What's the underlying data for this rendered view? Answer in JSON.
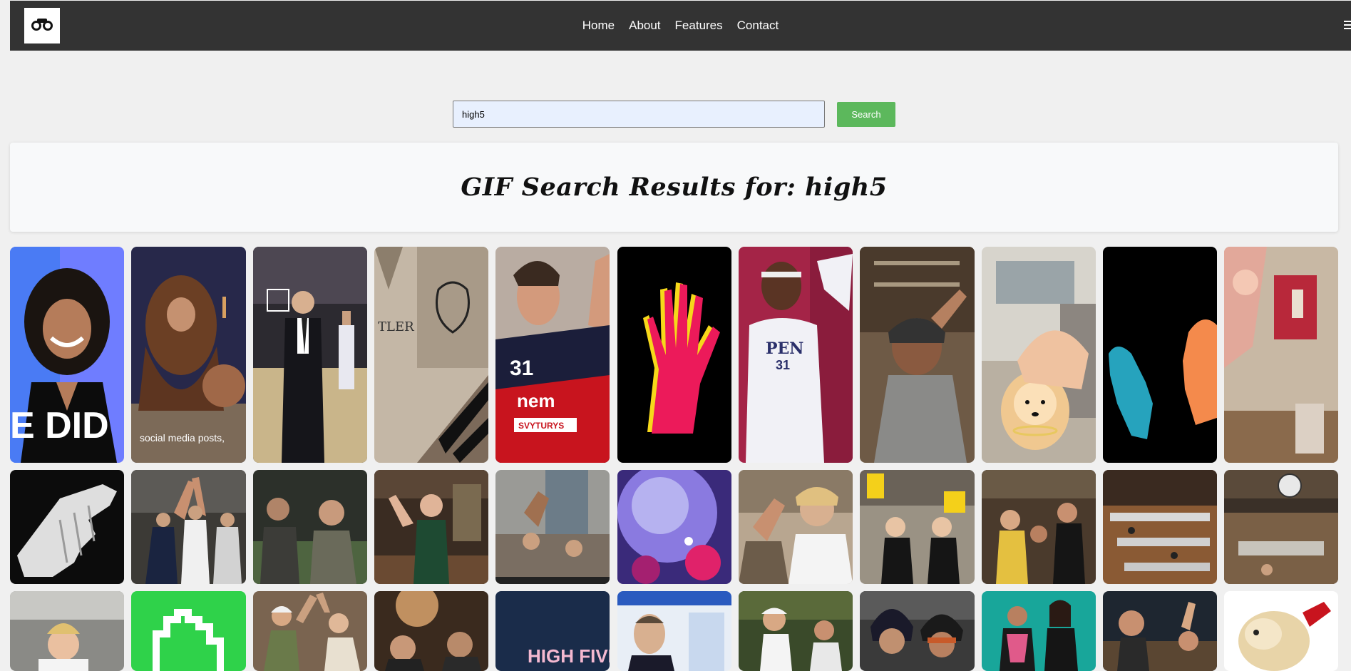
{
  "nav": {
    "logo_icon": "binoculars-icon",
    "links": [
      "Home",
      "About",
      "Features",
      "Contact"
    ],
    "menu_icon": "hamburger-menu-icon"
  },
  "search": {
    "value": "high5",
    "button_label": "Search"
  },
  "results": {
    "title": "GIF Search Results for: high5"
  },
  "gif_captions": {
    "gif_1": "E DID",
    "gif_2": "social media posts,",
    "gif_5_number": "31",
    "gif_5_brand": "nem",
    "gif_5_sponsor": "SVYTURYS",
    "gif_7_text": "PEN",
    "gif_7_number": "31",
    "gif_25_text": "HIGH FIVES"
  },
  "colors": {
    "navbar_bg": "#333333",
    "page_bg": "#f0f0f0",
    "search_button": "#5cb85c",
    "search_input_bg": "#e8f0fe"
  }
}
